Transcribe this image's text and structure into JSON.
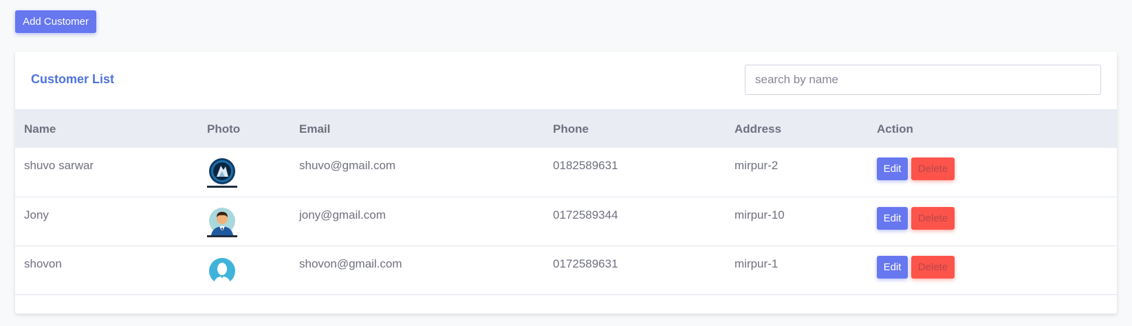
{
  "toolbar": {
    "add_customer_label": "Add Customer"
  },
  "card": {
    "title": "Customer List",
    "search_placeholder": "search by name"
  },
  "table": {
    "headers": [
      "Name",
      "Photo",
      "Email",
      "Phone",
      "Address",
      "Action"
    ],
    "rows": [
      {
        "name": "shuvo sarwar",
        "photo": "logo-avatar",
        "email": "shuvo@gmail.com",
        "phone": "0182589631",
        "address": "mirpur-2",
        "edit": "Edit",
        "delete": "Delete"
      },
      {
        "name": "Jony",
        "photo": "man-avatar",
        "email": "jony@gmail.com",
        "phone": "0172589344",
        "address": "mirpur-10",
        "edit": "Edit",
        "delete": "Delete"
      },
      {
        "name": "shovon",
        "photo": "person-silhouette-avatar",
        "email": "shovon@gmail.com",
        "phone": "0172589631",
        "address": "mirpur-1",
        "edit": "Edit",
        "delete": "Delete"
      }
    ]
  },
  "colors": {
    "primary": "#6777ef",
    "danger": "#fc544b",
    "title": "#4e73df",
    "header_bg": "#eaecf4"
  }
}
